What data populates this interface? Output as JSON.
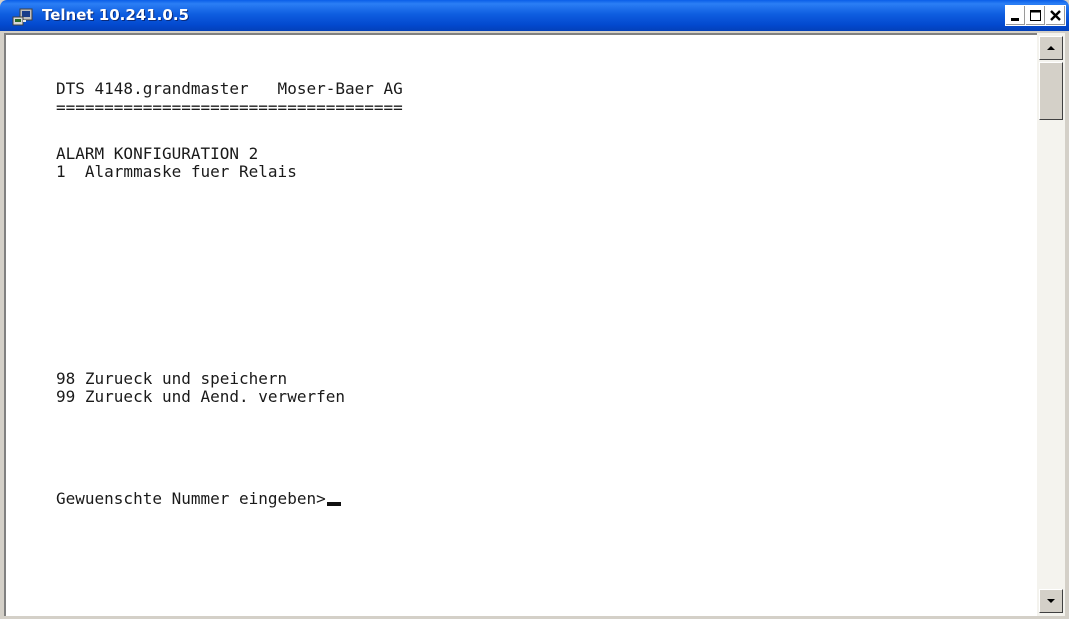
{
  "window": {
    "title": "Telnet 10.241.0.5"
  },
  "terminal": {
    "lines": [
      "DTS 4148.grandmaster   Moser-Baer AG",
      "====================================",
      "ALARM KONFIGURATION 2",
      "1  Alarmmaske fuer Relais",
      "98 Zurueck und speichern",
      "99 Zurueck und Aend. verwerfen"
    ],
    "prompt": "Gewuenschte Nummer eingeben>"
  },
  "icons": {
    "app": "telnet-console-icon",
    "minimize": "minimize-icon",
    "maximize": "maximize-icon",
    "close": "close-icon",
    "scroll_up": "scroll-up-arrow-icon",
    "scroll_down": "scroll-down-arrow-icon"
  },
  "colors": {
    "titlebar": "#0a5ee8",
    "close_button_x": "#000000",
    "terminal_bg": "#ffffff",
    "terminal_text": "#1a1a1a"
  }
}
